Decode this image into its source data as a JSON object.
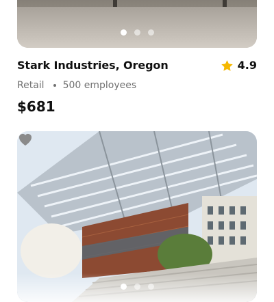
{
  "listing_top": {
    "carousel": {
      "count": 3,
      "active": 0
    },
    "title": "Stark Industries, Oregon",
    "rating": "4.9",
    "category": "Retail",
    "employees": "500 employees",
    "price": "$681",
    "icons": {
      "rating": "star-icon"
    }
  },
  "listing_bottom": {
    "carousel": {
      "count": 3,
      "active": 0
    },
    "icons": {
      "favorite": "heart-icon"
    }
  },
  "colors": {
    "star": "#F5B800",
    "text_primary": "#111111",
    "text_secondary": "#707070",
    "heart": "#8a8a8a"
  }
}
